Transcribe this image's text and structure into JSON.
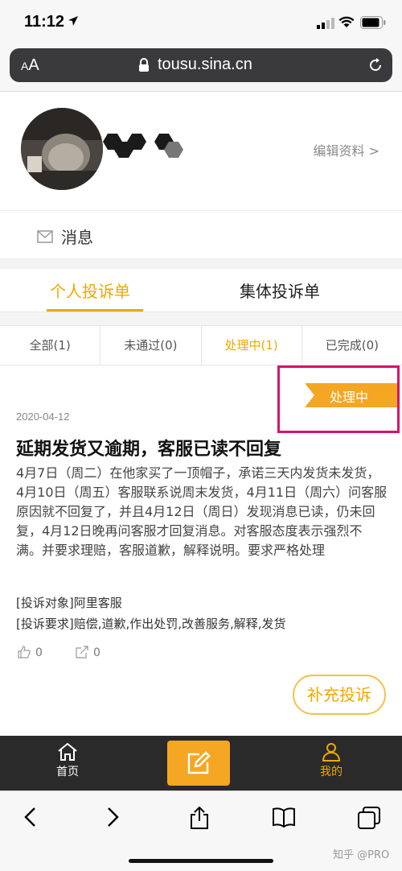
{
  "status_bar": {
    "time": "11:12"
  },
  "browser": {
    "aa_large": "A",
    "aa_small": "A",
    "url": "tousu.sina.cn"
  },
  "profile": {
    "edit_label": "编辑资料 >"
  },
  "messages": {
    "label": "消息"
  },
  "main_tabs": [
    {
      "label": "个人投诉单",
      "active": true
    },
    {
      "label": "集体投诉单",
      "active": false
    }
  ],
  "filters": [
    {
      "label": "全部(1)",
      "active": false
    },
    {
      "label": "未通过(0)",
      "active": false
    },
    {
      "label": "处理中(1)",
      "active": true
    },
    {
      "label": "已完成(0)",
      "active": false
    }
  ],
  "complaint": {
    "status": "处理中",
    "date": "2020-04-12",
    "title": "延期发货又逾期，客服已读不回复",
    "body": "4月7日（周二）在他家买了一顶帽子，承诺三天内发货未发货，4月10日（周五）客服联系说周末发货，4月11日（周六）问客服原因就不回复了，并且4月12日（周日）发现消息已读，仍未回复，4月12日晚再问客服才回复消息。对客服态度表示强烈不满。并要求理赔，客服道歉，解释说明。要求严格处理",
    "target_label": "[投诉对象]",
    "target_value": "阿里客服",
    "demand_label": "[投诉要求]",
    "demand_value": "赔偿,道歉,作出处罚,改善服务,解释,发货",
    "likes": "0",
    "shares": "0",
    "supplement_label": "补充投诉"
  },
  "app_nav": {
    "home": "首页",
    "mine": "我的"
  },
  "watermark": "知乎 @PRO",
  "colors": {
    "accent": "#f0a800",
    "ribbon": "#f5a623",
    "highlight": "#d6156c",
    "nav_bg": "#2a2a2a"
  }
}
